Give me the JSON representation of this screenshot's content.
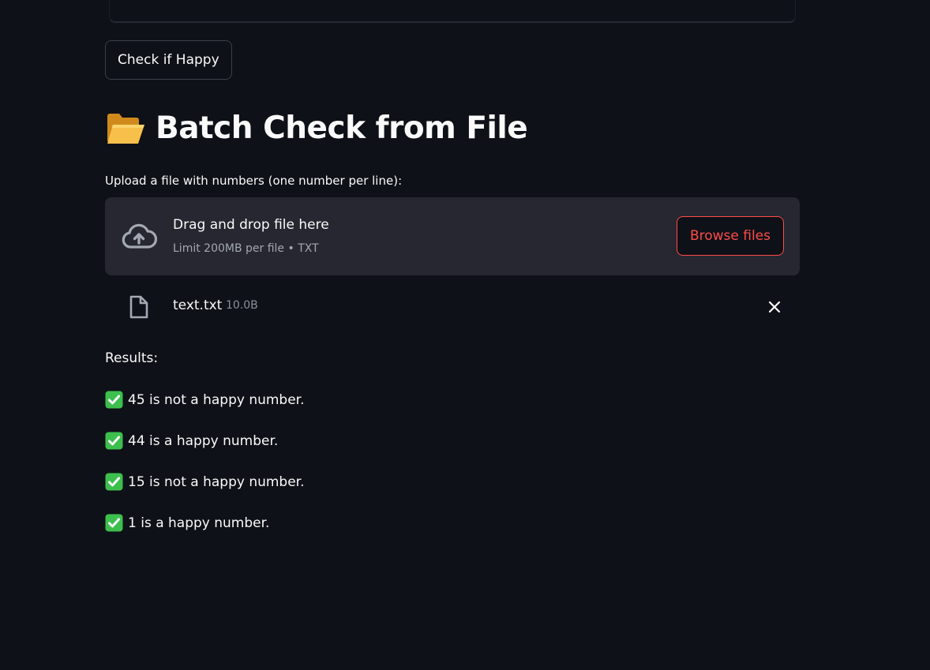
{
  "actions": {
    "check_button_label": "Check if Happy"
  },
  "batch": {
    "heading": "Batch Check from File",
    "upload_label": "Upload a file with numbers (one number per line):",
    "dropzone": {
      "title": "Drag and drop file here",
      "subtitle": "Limit 200MB per file • TXT",
      "browse_label": "Browse files"
    },
    "uploaded_file": {
      "name": "text.txt",
      "size": "10.0B"
    }
  },
  "results": {
    "label": "Results:",
    "items": [
      "45 is not a happy number.",
      "44 is a happy number.",
      "15 is not a happy number.",
      "1 is a happy number."
    ]
  },
  "colors": {
    "background": "#0e1117",
    "accent": "#ff4b4b",
    "dropzone": "#262730",
    "success": "#3dbf4e"
  },
  "icons": {
    "heading": "open-folder-icon",
    "dropzone": "cloud-upload-icon",
    "file": "file-icon",
    "remove": "close-icon",
    "result": "check-mark-button-icon"
  }
}
